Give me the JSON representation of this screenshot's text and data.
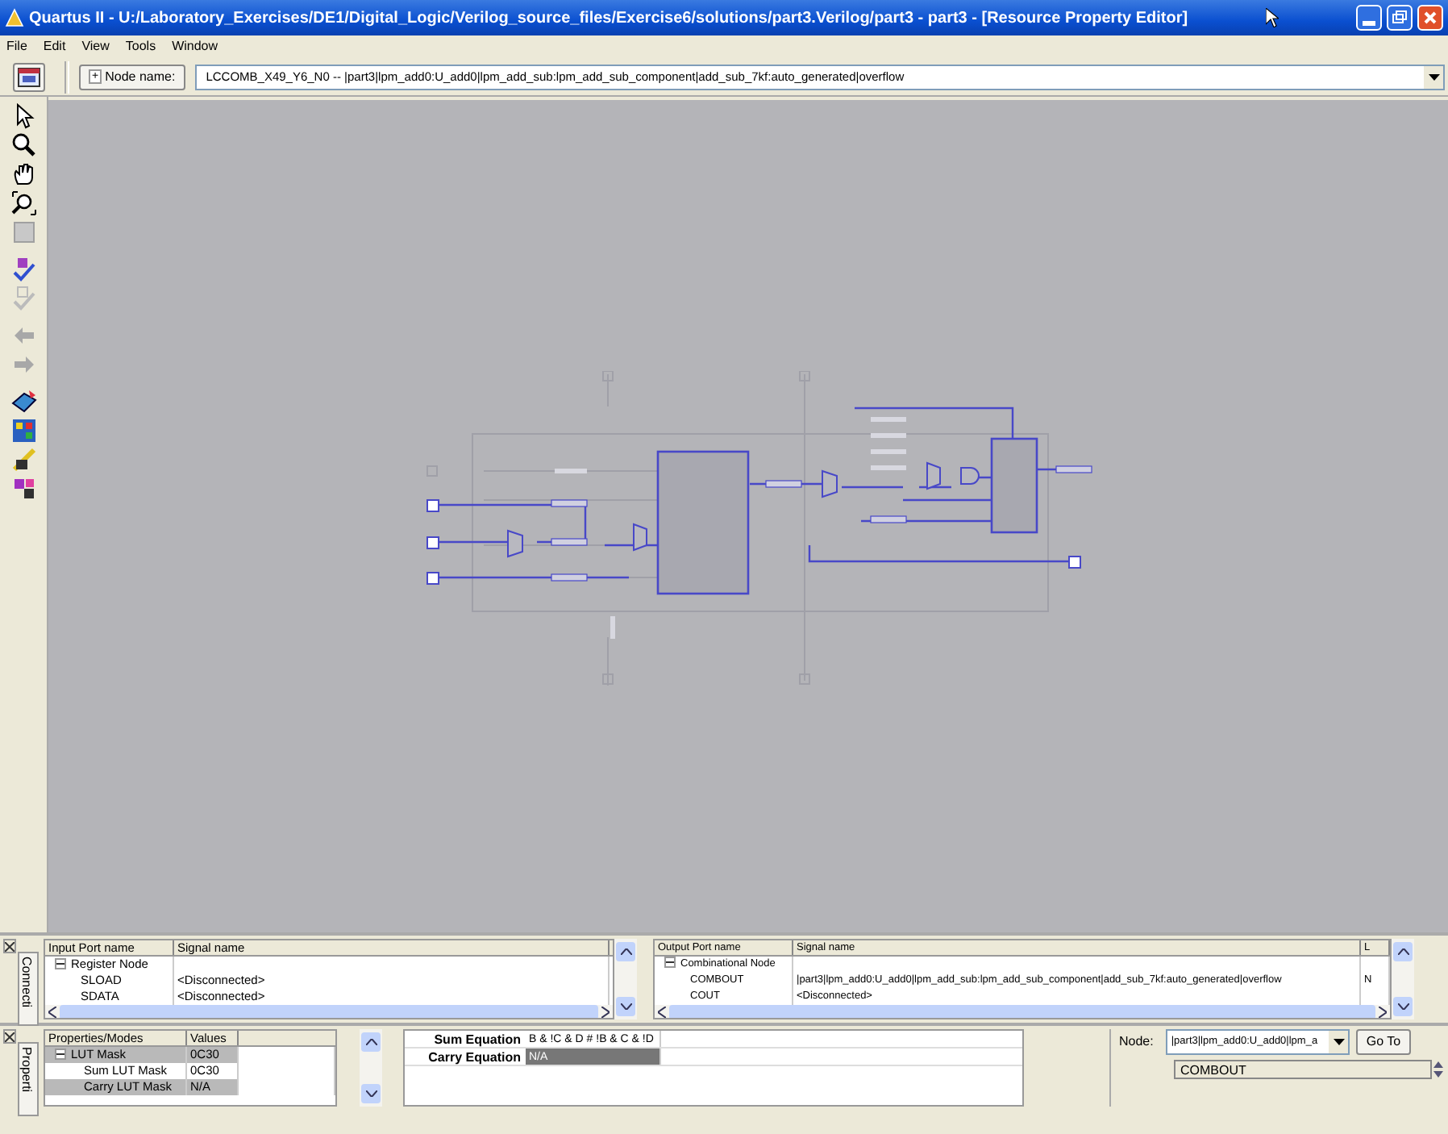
{
  "window": {
    "title": "Quartus II - U:/Laboratory_Exercises/DE1/Digital_Logic/Verilog_source_files/Exercise6/solutions/part3.Verilog/part3 - part3 - [Resource Property Editor]"
  },
  "menu": [
    "File",
    "Edit",
    "View",
    "Tools",
    "Window"
  ],
  "node_bar": {
    "expander": "+",
    "label": "Node name:",
    "value": "LCCOMB_X49_Y6_N0 -- |part3|lpm_add0:U_add0|lpm_add_sub:lpm_add_sub_component|add_sub_7kf:auto_generated|overflow"
  },
  "connectivity": {
    "tab": "Connecti",
    "inputs": {
      "columns": [
        "Input Port name",
        "Signal name"
      ],
      "rows": [
        {
          "kind": "group",
          "port": "Register Node",
          "signal": "",
          "expanded": true
        },
        {
          "kind": "item",
          "port": "SLOAD",
          "signal": "<Disconnected>"
        },
        {
          "kind": "item",
          "port": "SDATA",
          "signal": "<Disconnected>"
        }
      ]
    },
    "outputs": {
      "columns": [
        "Output Port name",
        "Signal name",
        "L"
      ],
      "rows": [
        {
          "kind": "group",
          "port": "Combinational Node",
          "signal": "",
          "column_3": "",
          "expanded": true
        },
        {
          "kind": "item",
          "port": "COMBOUT",
          "signal": "|part3|lpm_add0:U_add0|lpm_add_sub:lpm_add_sub_component|add_sub_7kf:auto_generated|overflow",
          "column_3": "N"
        },
        {
          "kind": "item",
          "port": "COUT",
          "signal": "<Disconnected>",
          "column_3": ""
        }
      ]
    }
  },
  "properties": {
    "tab": "Properti",
    "columns": [
      "Properties/Modes",
      "Values"
    ],
    "rows": [
      {
        "kind": "group",
        "name": "LUT Mask",
        "value": "0C30",
        "expanded": true,
        "selected": true
      },
      {
        "kind": "item",
        "name": "Sum LUT Mask",
        "value": "0C30",
        "selected": false
      },
      {
        "kind": "item",
        "name": "Carry LUT Mask",
        "value": "N/A",
        "selected": true
      }
    ]
  },
  "equations": [
    {
      "label": "Sum Equation",
      "value": "B & !C & D # !B & C & !D",
      "selected": false
    },
    {
      "label": "Carry Equation",
      "value": "N/A",
      "selected": true
    }
  ],
  "node_panel": {
    "label": "Node:",
    "value": "|part3|lpm_add0:U_add0|lpm_a",
    "button": "Go To",
    "ports": [
      "COMBOUT"
    ]
  }
}
